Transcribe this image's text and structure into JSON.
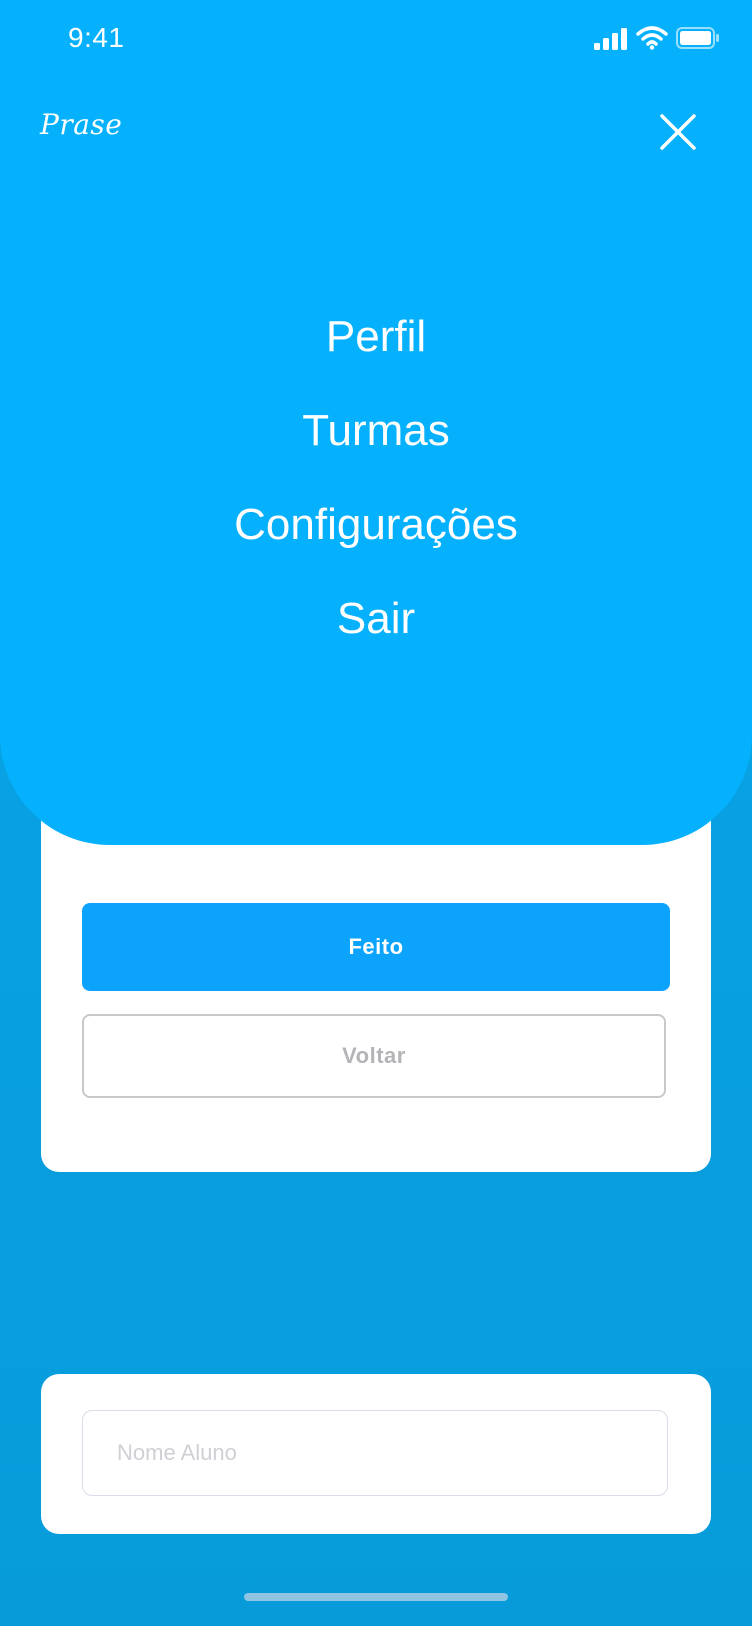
{
  "status_bar": {
    "time": "9:41",
    "icons": [
      "signal-icon",
      "wifi-icon",
      "battery-icon"
    ]
  },
  "header": {
    "logo": "Prase",
    "close_icon": "close-icon"
  },
  "menu": {
    "items": [
      {
        "label": "Perfil"
      },
      {
        "label": "Turmas"
      },
      {
        "label": "Configurações"
      },
      {
        "label": "Sair"
      }
    ]
  },
  "form": {
    "primary_button": "Feito",
    "secondary_button": "Voltar"
  },
  "student": {
    "name_placeholder": "Nome Aluno",
    "name_value": ""
  },
  "colors": {
    "menu_background": "#05b0fd",
    "page_background": "#0aa6ec",
    "primary_button": "#0ba3fb",
    "secondary_button_border": "#c8c8cc",
    "secondary_button_text": "#b4b4b8"
  }
}
